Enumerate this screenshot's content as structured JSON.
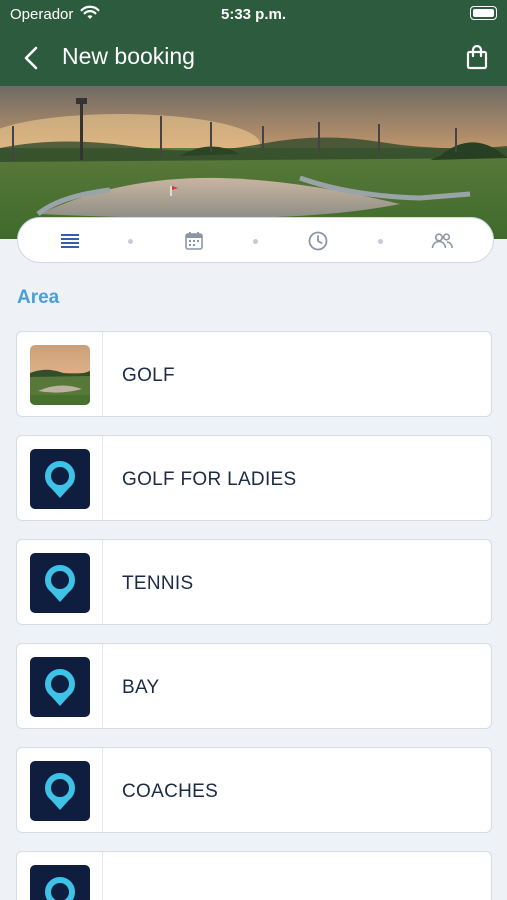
{
  "status_bar": {
    "carrier": "Operador",
    "time": "5:33 p.m."
  },
  "nav": {
    "title": "New booking",
    "back_icon": "chevron-left-icon",
    "bag_icon": "shopping-bag-icon"
  },
  "steps": [
    {
      "name": "list-icon",
      "active": true
    },
    {
      "name": "calendar-icon",
      "active": false
    },
    {
      "name": "clock-icon",
      "active": false
    },
    {
      "name": "people-icon",
      "active": false
    }
  ],
  "section": {
    "title": "Area"
  },
  "areas": [
    {
      "label": "GOLF",
      "thumb": "golf-course-photo"
    },
    {
      "label": "GOLF FOR LADIES",
      "thumb": "club-logo-icon"
    },
    {
      "label": "TENNIS",
      "thumb": "club-logo-icon"
    },
    {
      "label": "BAY",
      "thumb": "club-logo-icon"
    },
    {
      "label": "COACHES",
      "thumb": "club-logo-icon"
    },
    {
      "label": "",
      "thumb": "club-logo-icon"
    }
  ],
  "colors": {
    "header": "#2c5c3d",
    "accent": "#4a9fd8",
    "logo_bg": "#0f1e3f",
    "logo_ring": "#3dc3e8",
    "text_dark": "#1a2b45"
  }
}
